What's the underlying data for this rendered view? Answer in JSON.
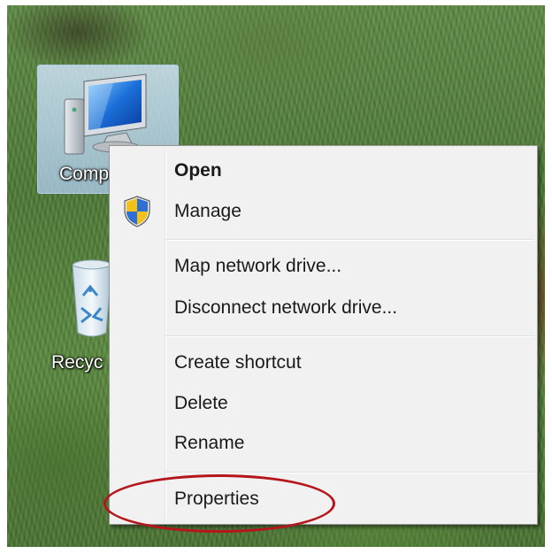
{
  "desktop": {
    "icons": [
      {
        "label": "Comp",
        "name": "computer"
      },
      {
        "label": "Recyc",
        "name": "recycle-bin"
      }
    ]
  },
  "context_menu": {
    "groups": [
      [
        {
          "label": "Open",
          "bold": true,
          "icon": ""
        },
        {
          "label": "Manage",
          "bold": false,
          "icon": "uac-shield-icon"
        }
      ],
      [
        {
          "label": "Map network drive...",
          "bold": false,
          "icon": ""
        },
        {
          "label": "Disconnect network drive...",
          "bold": false,
          "icon": ""
        }
      ],
      [
        {
          "label": "Create shortcut",
          "bold": false,
          "icon": ""
        },
        {
          "label": "Delete",
          "bold": false,
          "icon": ""
        },
        {
          "label": "Rename",
          "bold": false,
          "icon": ""
        }
      ],
      [
        {
          "label": "Properties",
          "bold": false,
          "icon": "",
          "annotated": true
        }
      ]
    ]
  },
  "annotation": {
    "shape": "ellipse",
    "color": "#b4161b",
    "target": "Properties"
  }
}
